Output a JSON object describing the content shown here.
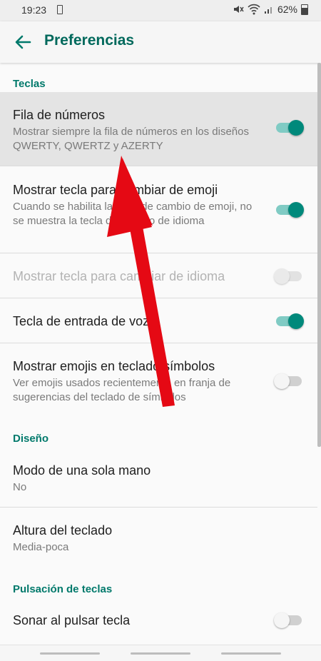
{
  "status_bar": {
    "time": "19:23",
    "battery": "62%"
  },
  "app_bar": {
    "title": "Preferencias"
  },
  "sections": {
    "keys": "Teclas",
    "design": "Diseño",
    "keypress": "Pulsación de teclas"
  },
  "settings": {
    "number_row": {
      "title": "Fila de números",
      "summary": "Mostrar siempre la fila de números en los diseños QWERTY, QWERTZ y AZERTY",
      "enabled": true
    },
    "emoji_key": {
      "title": "Mostrar tecla para cambiar de emoji",
      "summary": "Cuando se habilita la tecla de cambio de emoji, no se muestra la tecla de cambio de idioma",
      "enabled": true
    },
    "language_key": {
      "title": "Mostrar tecla para cambiar de idioma",
      "enabled": false,
      "disabled": true
    },
    "voice_key": {
      "title": "Tecla de entrada de voz",
      "enabled": true
    },
    "symbol_emojis": {
      "title": "Mostrar emojis en teclado símbolos",
      "summary": "Ver emojis usados recientemente en franja de sugerencias del teclado de símbolos",
      "enabled": false
    },
    "one_hand": {
      "title": "Modo de una sola mano",
      "value": "No"
    },
    "keyboard_height": {
      "title": "Altura del teclado",
      "value": "Media-poca"
    },
    "key_sound": {
      "title": "Sonar al pulsar tecla",
      "enabled": false
    }
  },
  "colors": {
    "accent": "#00796b",
    "toggle_on": "#00897b",
    "arrow": "#e50914"
  }
}
